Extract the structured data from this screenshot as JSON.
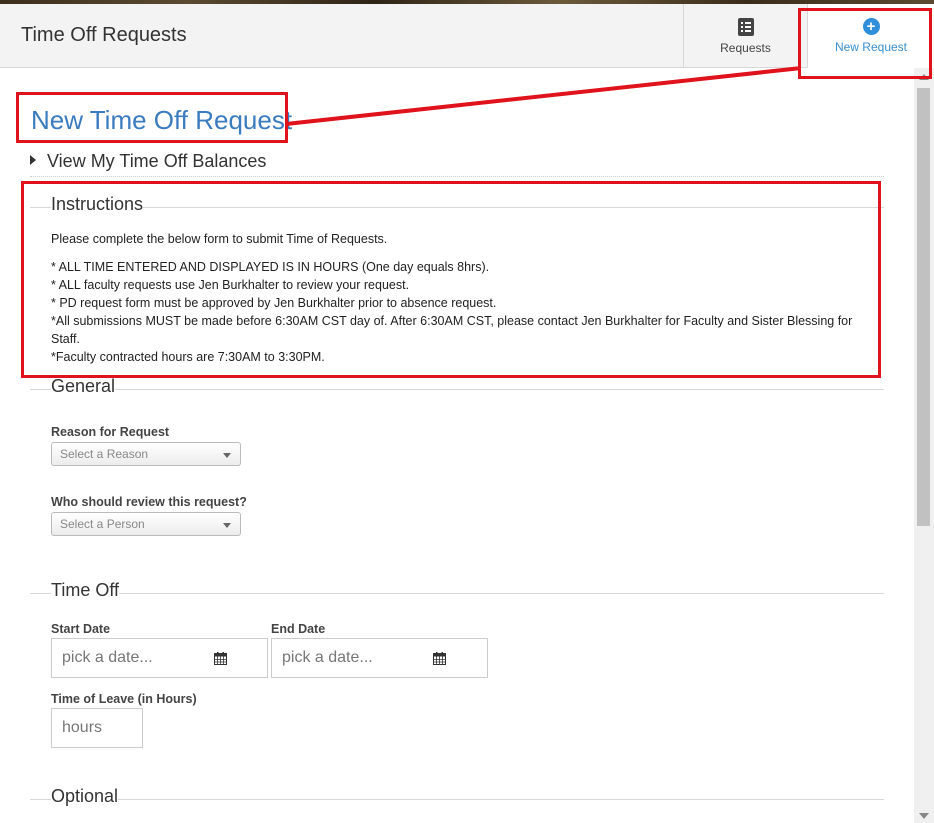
{
  "header": {
    "app_title": "Time Off Requests",
    "tabs": [
      {
        "label": "Requests",
        "icon": "checklist-icon"
      },
      {
        "label": "New Request",
        "icon": "plus-circle-icon"
      }
    ]
  },
  "page": {
    "heading": "New Time Off Request",
    "balances_toggle": "View My Time Off Balances"
  },
  "instructions": {
    "legend": "Instructions",
    "intro": "Please complete the below form to submit Time of Requests.",
    "lines": [
      "* ALL TIME ENTERED AND DISPLAYED IS IN HOURS (One day equals 8hrs).",
      "* ALL faculty requests use Jen Burkhalter to review your request.",
      "* PD request form must be approved by Jen Burkhalter prior to absence request.",
      "*All submissions MUST be made before 6:30AM CST day of. After 6:30AM CST, please contact Jen Burkhalter for Faculty and Sister Blessing for Staff.",
      "*Faculty contracted hours are 7:30AM to 3:30PM."
    ]
  },
  "general": {
    "legend": "General",
    "reason_label": "Reason for Request",
    "reason_placeholder": "Select a Reason",
    "reviewer_label": "Who should review this request?",
    "reviewer_placeholder": "Select a Person"
  },
  "time_off": {
    "legend": "Time Off",
    "start_label": "Start Date",
    "start_placeholder": "pick a date...",
    "end_label": "End Date",
    "end_placeholder": "pick a date...",
    "hours_label": "Time of Leave (in Hours)",
    "hours_placeholder": "hours"
  },
  "optional": {
    "legend": "Optional"
  },
  "colors": {
    "accent": "#3b7bbf",
    "annotation": "#e0121c",
    "new_request_icon": "#2f8fd9"
  }
}
